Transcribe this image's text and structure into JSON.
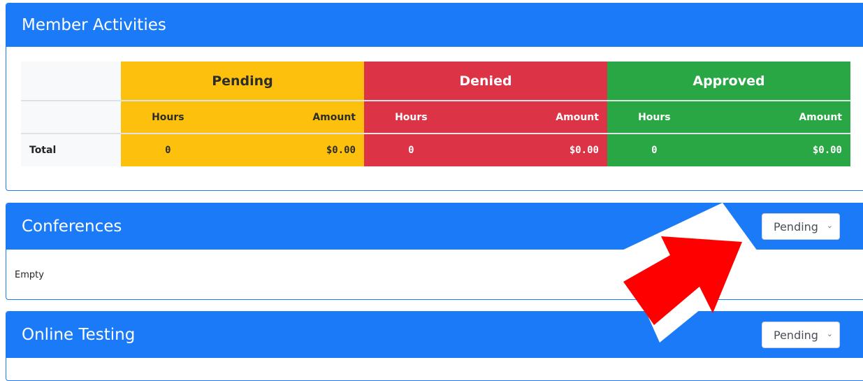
{
  "member_activities": {
    "title": "Member Activities",
    "groups": [
      "Pending",
      "Denied",
      "Approved"
    ],
    "sub_headers": {
      "hours": "Hours",
      "amount": "Amount"
    },
    "total_row": {
      "label": "Total",
      "pending": {
        "hours": "0",
        "amount": "$0.00"
      },
      "denied": {
        "hours": "0",
        "amount": "$0.00"
      },
      "approved": {
        "hours": "0",
        "amount": "$0.00"
      }
    },
    "colors": {
      "pending": "#fdc10d",
      "denied": "#dc3446",
      "approved": "#2aa745",
      "header": "#1a7af8"
    }
  },
  "conferences": {
    "title": "Conferences",
    "filter": {
      "selected": "Pending"
    },
    "empty_text": "Empty"
  },
  "online_testing": {
    "title": "Online Testing",
    "filter": {
      "selected": "Pending"
    }
  }
}
